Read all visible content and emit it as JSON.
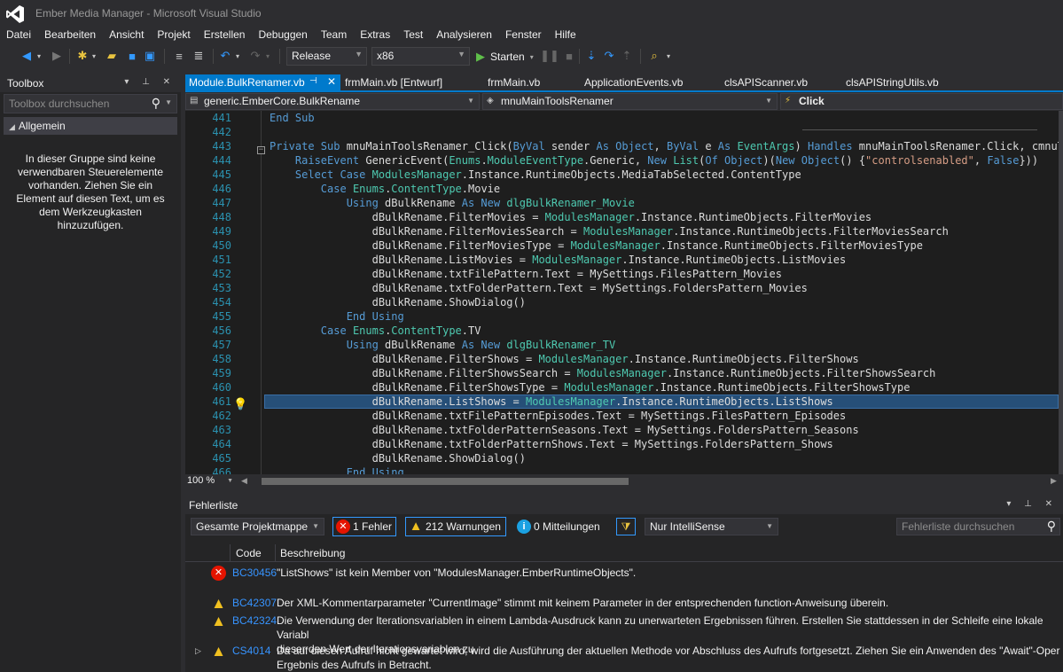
{
  "window": {
    "title": "Ember Media Manager - Microsoft Visual Studio"
  },
  "menu": [
    "Datei",
    "Bearbeiten",
    "Ansicht",
    "Projekt",
    "Erstellen",
    "Debuggen",
    "Team",
    "Extras",
    "Test",
    "Analysieren",
    "Fenster",
    "Hilfe"
  ],
  "toolbar": {
    "configuration": "Release",
    "platform": "x86",
    "start_label": "Starten"
  },
  "toolbox": {
    "title": "Toolbox",
    "search_placeholder": "Toolbox durchsuchen",
    "group": "Allgemein",
    "empty_message": "In dieser Gruppe sind keine verwendbaren Steuerelemente vorhanden. Ziehen Sie ein Element auf diesen Text, um es dem Werkzeugkasten hinzuzufügen."
  },
  "tabs": [
    {
      "label": "Module.BulkRenamer.vb",
      "active": true
    },
    {
      "label": "frmMain.vb [Entwurf]"
    },
    {
      "label": "frmMain.vb"
    },
    {
      "label": "ApplicationEvents.vb"
    },
    {
      "label": "clsAPIScanner.vb"
    },
    {
      "label": "clsAPIStringUtils.vb"
    }
  ],
  "navbar": {
    "project": "generic.EmberCore.BulkRename",
    "object": "mnuMainToolsRenamer",
    "member": "Click"
  },
  "editor": {
    "highlighted_line": "461",
    "lines": [
      {
        "n": "441",
        "html": "<span class='kw'>End Sub</span>"
      },
      {
        "n": "442",
        "html": ""
      },
      {
        "n": "443",
        "html": "<span class='kw'>Private Sub</span> mnuMainToolsRenamer_Click(<span class='kw'>ByVal</span> sender <span class='kw'>As</span> <span class='kw'>Object</span>, <span class='kw'>ByVal</span> e <span class='kw'>As</span> <span class='ty'>EventArgs</span>) <span class='kw'>Handles</span> mnuMainToolsRenamer.Click, cmnuTray"
      },
      {
        "n": "444",
        "html": "    <span class='kw'>RaiseEvent</span> GenericEvent(<span class='ty'>Enums</span>.<span class='ty'>ModuleEventType</span>.Generic, <span class='kw'>New</span> <span class='ty'>List</span>(<span class='kw'>Of</span> <span class='kw'>Object</span>)(<span class='kw'>New</span> <span class='kw'>Object</span>() {<span class='str'>\"controlsenabled\"</span>, <span class='kw'>False</span>}))"
      },
      {
        "n": "445",
        "html": "    <span class='kw'>Select Case</span> <span class='ty'>ModulesManager</span>.Instance.RuntimeObjects.MediaTabSelected.ContentType"
      },
      {
        "n": "446",
        "html": "        <span class='kw'>Case</span> <span class='ty'>Enums</span>.<span class='ty'>ContentType</span>.Movie"
      },
      {
        "n": "447",
        "html": "            <span class='kw'>Using</span> dBulkRename <span class='kw'>As New</span> <span class='ty'>dlgBulkRenamer_Movie</span>"
      },
      {
        "n": "448",
        "html": "                dBulkRename.FilterMovies = <span class='ty'>ModulesManager</span>.Instance.RuntimeObjects.FilterMovies"
      },
      {
        "n": "449",
        "html": "                dBulkRename.FilterMoviesSearch = <span class='ty'>ModulesManager</span>.Instance.RuntimeObjects.FilterMoviesSearch"
      },
      {
        "n": "450",
        "html": "                dBulkRename.FilterMoviesType = <span class='ty'>ModulesManager</span>.Instance.RuntimeObjects.FilterMoviesType"
      },
      {
        "n": "451",
        "html": "                dBulkRename.ListMovies = <span class='ty'>ModulesManager</span>.Instance.RuntimeObjects.ListMovies"
      },
      {
        "n": "452",
        "html": "                dBulkRename.txtFilePattern.Text = MySettings.FilesPattern_Movies"
      },
      {
        "n": "453",
        "html": "                dBulkRename.txtFolderPattern.Text = MySettings.FoldersPattern_Movies"
      },
      {
        "n": "454",
        "html": "                dBulkRename.ShowDialog()"
      },
      {
        "n": "455",
        "html": "            <span class='kw'>End Using</span>"
      },
      {
        "n": "456",
        "html": "        <span class='kw'>Case</span> <span class='ty'>Enums</span>.<span class='ty'>ContentType</span>.TV"
      },
      {
        "n": "457",
        "html": "            <span class='kw'>Using</span> dBulkRename <span class='kw'>As New</span> <span class='ty'>dlgBulkRenamer_TV</span>"
      },
      {
        "n": "458",
        "html": "                dBulkRename.FilterShows = <span class='ty'>ModulesManager</span>.Instance.RuntimeObjects.FilterShows"
      },
      {
        "n": "459",
        "html": "                dBulkRename.FilterShowsSearch = <span class='ty'>ModulesManager</span>.Instance.RuntimeObjects.FilterShowsSearch"
      },
      {
        "n": "460",
        "html": "                dBulkRename.FilterShowsType = <span class='ty'>ModulesManager</span>.Instance.RuntimeObjects.FilterShowsType"
      },
      {
        "n": "461",
        "html": "                dBulkRename.ListShows = <span class='ty'>ModulesManager</span>.Instance.RuntimeObjects.ListShows"
      },
      {
        "n": "462",
        "html": "                dBulkRename.txtFilePatternEpisodes.Text = MySettings.FilesPattern_Episodes"
      },
      {
        "n": "463",
        "html": "                dBulkRename.txtFolderPatternSeasons.Text = MySettings.FoldersPattern_Seasons"
      },
      {
        "n": "464",
        "html": "                dBulkRename.txtFolderPatternShows.Text = MySettings.FoldersPattern_Shows"
      },
      {
        "n": "465",
        "html": "                dBulkRename.ShowDialog()"
      },
      {
        "n": "466",
        "html": "            <span class='kw'>End Using</span>"
      }
    ],
    "zoom": "100 %"
  },
  "errorlist": {
    "title": "Fehlerliste",
    "scope": "Gesamte Projektmappe",
    "errors_label": "1 Fehler",
    "warnings_label": "212 Warnungen",
    "messages_label": "0 Mitteilungen",
    "build_filter": "Nur IntelliSense",
    "search_placeholder": "Fehlerliste durchsuchen",
    "columns": {
      "code": "Code",
      "description": "Beschreibung"
    },
    "rows": [
      {
        "severity": "error",
        "code": "BC30456",
        "description": "\"ListShows\" ist kein Member von \"ModulesManager.EmberRuntimeObjects\"."
      },
      {
        "severity": "warning",
        "code": "BC42307",
        "description": "Der XML-Kommentarparameter \"CurrentImage\" stimmt mit keinem Parameter in der entsprechenden function-Anweisung überein."
      },
      {
        "severity": "warning",
        "code": "BC42324",
        "description": "Die Verwendung der Iterationsvariablen in einem Lambda-Ausdruck kann zu unerwarteten Ergebnissen führen. Erstellen Sie stattdessen in der Schleife eine lokale Variabl\ndieser den Wert der Iterationsvariablen zu."
      },
      {
        "severity": "warning",
        "code": "CS4014",
        "description": "Da auf diesen Aufruf nicht gewartet wird, wird die Ausführung der aktuellen Methode vor Abschluss des Aufrufs fortgesetzt. Ziehen Sie ein Anwenden des \"Await\"-Oper\nErgebnis des Aufrufs in Betracht.",
        "expandable": true
      }
    ]
  },
  "colors": {
    "accent": "#007acc",
    "selection": "#264f78",
    "keyword": "#569cd6",
    "type": "#4ec9b0",
    "string": "#d69d85"
  }
}
